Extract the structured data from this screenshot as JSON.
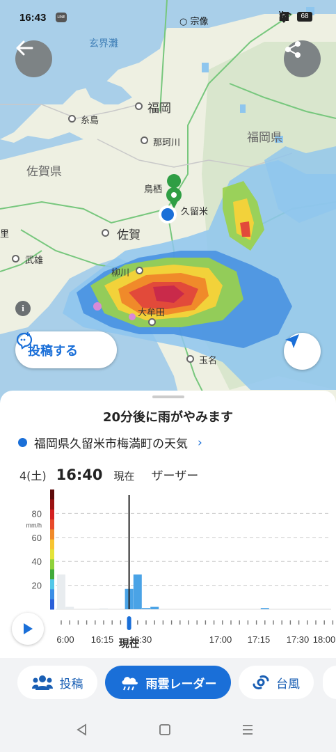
{
  "status_bar": {
    "time": "16:43",
    "line_badge": "LINE",
    "carrier_label": "宗像",
    "battery": "68",
    "volte_label": "Vo LTE"
  },
  "map": {
    "sea_label": "玄界灘",
    "pref_labels": [
      "佐賀県",
      "福岡県"
    ],
    "cities": {
      "fukuoka": "福岡",
      "itoshima": "糸島",
      "nakagawa": "那珂川",
      "tosu": "鳥栖",
      "kurume": "久留米",
      "saga": "佐賀",
      "takeo": "武雄",
      "yanagawa": "柳川",
      "omuta": "大牟田",
      "tamana": "玉名",
      "ri": "里"
    },
    "post_button_label": "投稿する",
    "icons": {
      "back": "back-arrow-icon",
      "share": "share-icon",
      "info": "info-icon",
      "locate": "navigation-arrow-icon",
      "post": "chat-bubble-plus-icon"
    }
  },
  "sheet": {
    "headline": "20分後に雨がやみます",
    "place": "福岡県久留米市梅満町の天気",
    "date": "4(土)",
    "time": "16:40",
    "now_label": "現在",
    "status": "ザーザー",
    "timeline_labels": [
      "6:00",
      "16:15",
      "16:30",
      "現在",
      "17:00",
      "17:15",
      "17:30",
      "18:00"
    ]
  },
  "chart_data": {
    "type": "bar",
    "unit": "mm/h",
    "y_ticks": [
      20,
      40,
      60,
      80
    ],
    "ylim": [
      0,
      100
    ],
    "x_labels": [
      "6:00",
      "16:15",
      "16:30",
      "現在",
      "17:00",
      "17:15",
      "17:30",
      "18:00"
    ],
    "bars": [
      {
        "time": "16:00",
        "value": 29,
        "past": true
      },
      {
        "time": "16:05",
        "value": 2,
        "past": true
      },
      {
        "time": "16:25",
        "value": 0.5,
        "past": true
      },
      {
        "time": "16:40",
        "value": 17,
        "past": false
      },
      {
        "time": "16:45",
        "value": 29,
        "past": false
      },
      {
        "time": "16:50",
        "value": 1,
        "past": false
      },
      {
        "time": "16:55",
        "value": 2,
        "past": false
      },
      {
        "time": "18:00",
        "value": 1,
        "past": false
      }
    ],
    "color_scale": [
      "#5d0a0a",
      "#9b1313",
      "#d32020",
      "#e84a2a",
      "#f08a2a",
      "#f7c431",
      "#e4e339",
      "#8fd13a",
      "#3faa3a",
      "#52c7e8",
      "#3a8ee6",
      "#2a5fd8"
    ],
    "colors": {
      "past": "#e8ecef",
      "future": "#4aa3e6",
      "current_line": "#222222"
    }
  },
  "tabs": {
    "post_label": "投稿",
    "radar_label": "雨雲レーダー",
    "typhoon_label": "台風",
    "active_color": "#1a6fd8"
  }
}
